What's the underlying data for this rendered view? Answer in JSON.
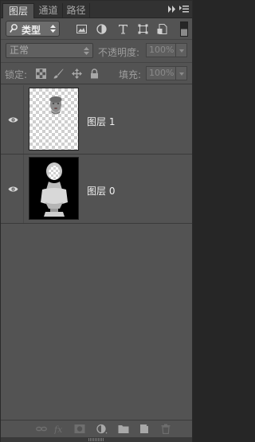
{
  "tabs": [
    {
      "label": "图层",
      "active": true
    },
    {
      "label": "通道",
      "active": false
    },
    {
      "label": "路径",
      "active": false
    }
  ],
  "filter": {
    "kind_label": "类型",
    "icons": [
      "image-filter-icon",
      "adjustment-filter-icon",
      "type-filter-icon",
      "shape-filter-icon",
      "smart-object-filter-icon"
    ]
  },
  "blend": {
    "mode": "正常",
    "opacity_label": "不透明度:",
    "opacity_value": "100%"
  },
  "lock": {
    "label": "锁定:",
    "fill_label": "填充:",
    "fill_value": "100%"
  },
  "layers": [
    {
      "name": "图层 1",
      "visible": true,
      "thumbnail": "transparent-face"
    },
    {
      "name": "图层 0",
      "visible": true,
      "thumbnail": "bust-on-black"
    }
  ],
  "colors": {
    "panel_bg": "#535353",
    "tab_bar_bg": "#323232",
    "text_active": "#e8e8e8"
  }
}
